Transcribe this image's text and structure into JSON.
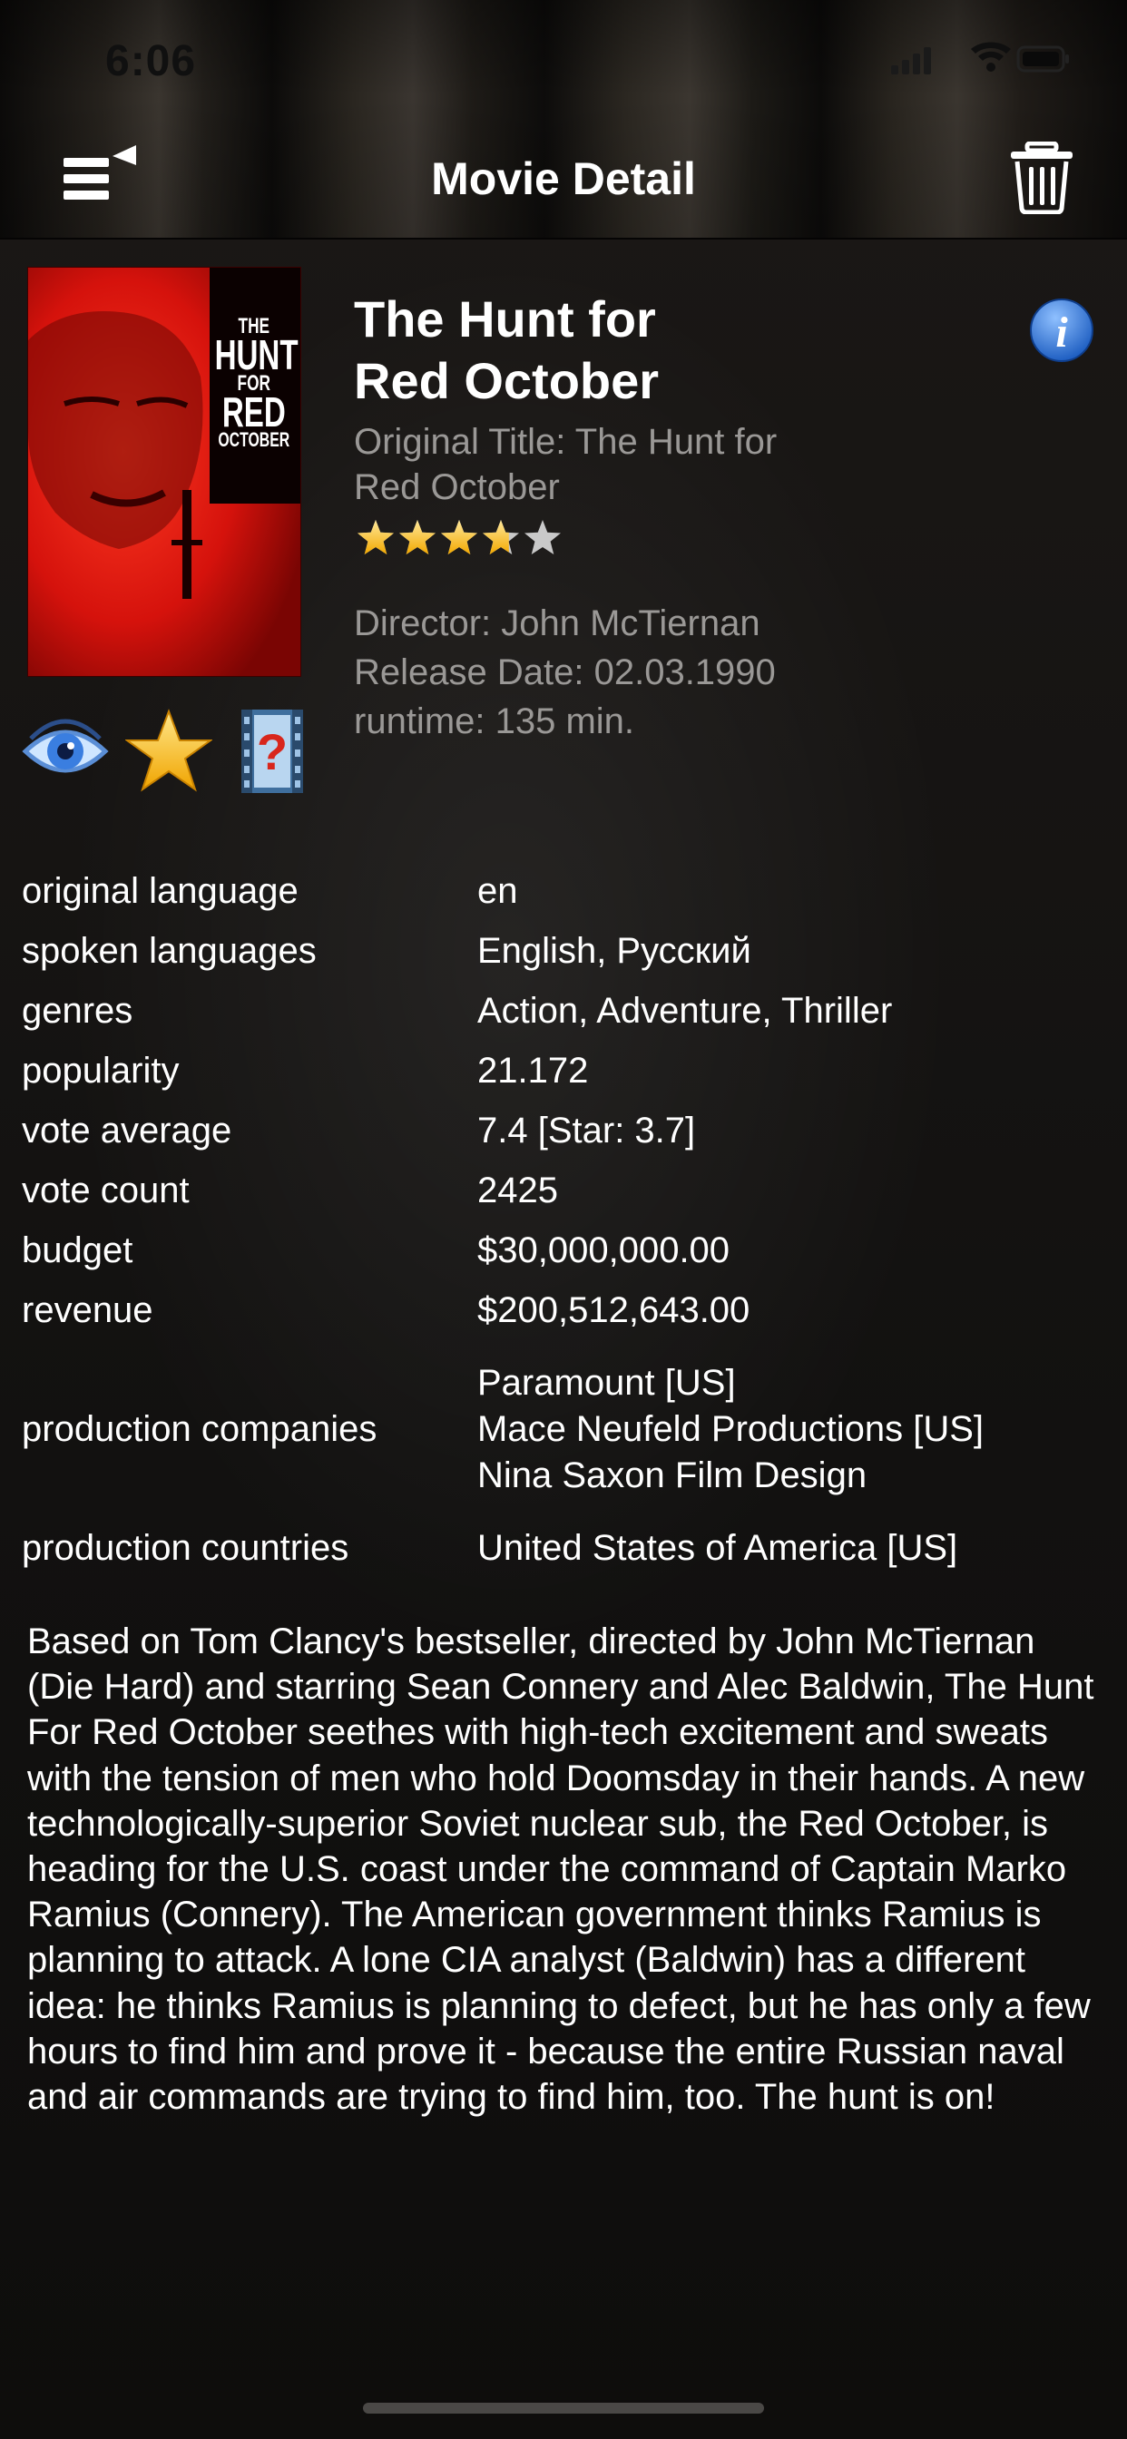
{
  "status_bar": {
    "time": "6:06"
  },
  "nav": {
    "title": "Movie Detail"
  },
  "poster": {
    "line1": "THE",
    "line2": "HUNT",
    "line3": "FOR",
    "line4": "RED",
    "line5": "OCTOBER"
  },
  "movie": {
    "title_line1": "The Hunt for",
    "title_line2": "Red October",
    "original_title_line1": "Original Title: The Hunt for",
    "original_title_line2": "Red October",
    "star_rating": 3.7,
    "director": "Director: John McTiernan",
    "release_date": "Release Date: 02.03.1990",
    "runtime": "runtime: 135 min."
  },
  "details": [
    {
      "key": "original language",
      "values": [
        "en"
      ]
    },
    {
      "key": "spoken languages",
      "values": [
        "English, Русский"
      ]
    },
    {
      "key": "genres",
      "values": [
        "Action, Adventure, Thriller"
      ]
    },
    {
      "key": "popularity",
      "values": [
        "21.172"
      ]
    },
    {
      "key": "vote average",
      "values": [
        "7.4 [Star: 3.7]"
      ]
    },
    {
      "key": "vote count",
      "values": [
        "2425"
      ]
    },
    {
      "key": "budget",
      "values": [
        "$30,000,000.00"
      ]
    },
    {
      "key": "revenue",
      "values": [
        "$200,512,643.00"
      ]
    },
    {
      "key": "production companies",
      "values": [
        "Paramount [US]",
        "Mace Neufeld Productions [US]",
        "Nina Saxon Film Design"
      ]
    },
    {
      "key": "production countries",
      "values": [
        "United States of America [US]"
      ]
    }
  ],
  "overview": "Based on Tom Clancy's bestseller, directed by John McTiernan (Die Hard) and starring Sean Connery and Alec Baldwin, The Hunt For Red October seethes with high-tech excitement and sweats with the tension of men who hold Doomsday in their hands. A new technologically-superior Soviet nuclear sub, the Red October, is heading for the U.S. coast under the command of Captain Marko Ramius (Connery). The American government thinks Ramius is planning to attack. A lone CIA analyst (Baldwin) has a different idea: he thinks Ramius is planning to defect, but he has only a few hours to find him and prove it - because the entire Russian naval and air commands are trying to find him, too. The hunt is on!"
}
